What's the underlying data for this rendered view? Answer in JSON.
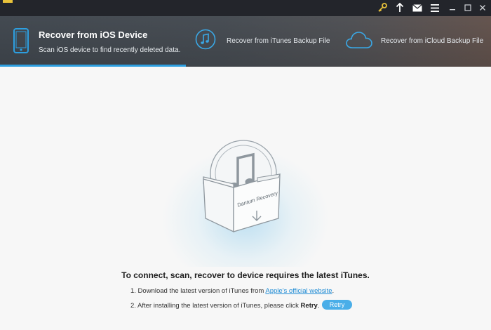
{
  "titlebar": {
    "icons": [
      "key-icon",
      "upload-icon",
      "mail-icon",
      "menu-icon",
      "minimize-icon",
      "maximize-icon",
      "close-icon"
    ]
  },
  "tabs": [
    {
      "title": "Recover from iOS Device",
      "subtitle": "Scan iOS device to find recently deleted data.",
      "icon": "phone-icon",
      "active": true
    },
    {
      "title": "Recover from iTunes Backup File",
      "icon": "music-note-icon",
      "active": false
    },
    {
      "title": "Recover from iCloud Backup File",
      "icon": "cloud-icon",
      "active": false
    }
  ],
  "main": {
    "box_label": "Dantum Recovery",
    "heading": "To connect, scan, recover to device requires the latest iTunes.",
    "step1_prefix": "1. Download the latest version of iTunes from ",
    "step1_link": "Apple's official website",
    "step1_suffix": ".",
    "step2_prefix": "2. After installing the latest version of iTunes, please click ",
    "step2_bold": "Retry",
    "step2_suffix": ".",
    "retry_label": "Retry"
  },
  "colors": {
    "accent": "#2d9fe0",
    "link": "#1e8bd4",
    "retry_button": "#4aaee8",
    "titlebar": "#23252b",
    "key_icon": "#e8c23a"
  }
}
